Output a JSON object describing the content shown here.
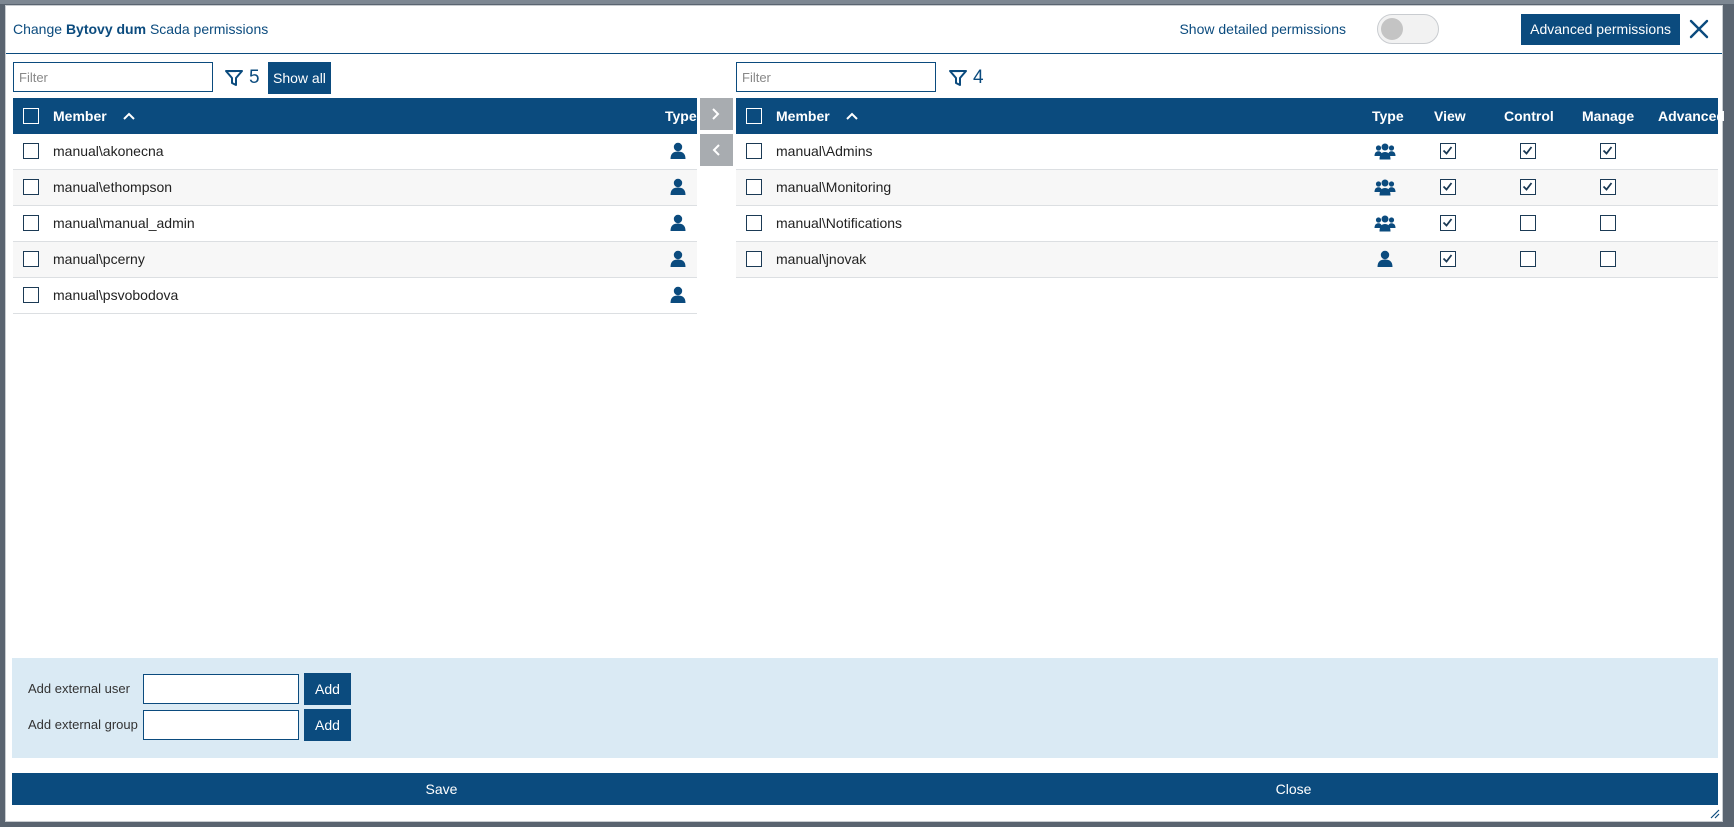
{
  "dialog": {
    "title_prefix": "Change ",
    "title_bold": "Bytovy dum",
    "title_suffix": " Scada permissions",
    "show_detailed_label": "Show detailed permissions",
    "advanced_button": "Advanced permissions"
  },
  "left": {
    "filter_placeholder": "Filter",
    "count": "5",
    "show_all": "Show all",
    "columns": {
      "member": "Member",
      "type": "Type"
    },
    "rows": [
      {
        "member": "manual\\akonecna",
        "type": "user"
      },
      {
        "member": "manual\\ethompson",
        "type": "user"
      },
      {
        "member": "manual\\manual_admin",
        "type": "user"
      },
      {
        "member": "manual\\pcerny",
        "type": "user"
      },
      {
        "member": "manual\\psvobodova",
        "type": "user"
      }
    ]
  },
  "right": {
    "filter_placeholder": "Filter",
    "count": "4",
    "columns": {
      "member": "Member",
      "type": "Type",
      "view": "View",
      "control": "Control",
      "manage": "Manage",
      "advanced": "Advanced"
    },
    "rows": [
      {
        "member": "manual\\Admins",
        "type": "group",
        "view": true,
        "control": true,
        "manage": true
      },
      {
        "member": "manual\\Monitoring",
        "type": "group",
        "view": true,
        "control": true,
        "manage": true
      },
      {
        "member": "manual\\Notifications",
        "type": "group",
        "view": true,
        "control": false,
        "manage": false
      },
      {
        "member": "manual\\jnovak",
        "type": "user",
        "view": true,
        "control": false,
        "manage": false
      }
    ]
  },
  "external": {
    "user_label": "Add external user",
    "group_label": "Add external group",
    "add_label": "Add"
  },
  "footer": {
    "save": "Save",
    "close": "Close"
  },
  "colors": {
    "primary": "#0b4b7e",
    "panel": "#daeaf4",
    "arrow": "#a8acb0"
  },
  "icons": {
    "user": "user-icon",
    "group": "group-icon",
    "filter": "filter-icon",
    "close": "close-icon",
    "move_right": "chevron-right-icon",
    "move_left": "chevron-left-icon"
  }
}
